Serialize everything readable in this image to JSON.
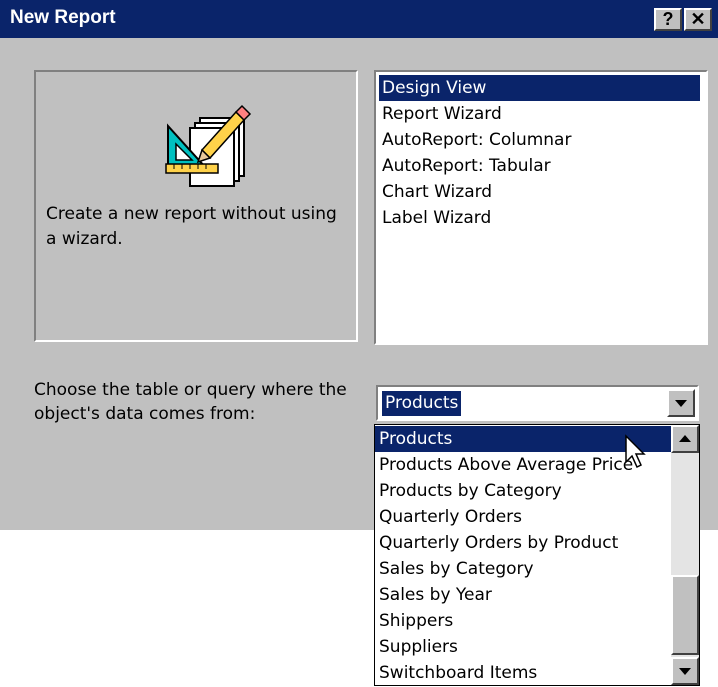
{
  "window": {
    "title": "New Report",
    "help_button": "?",
    "close_button": "✕"
  },
  "preview": {
    "description": "Create a new report without using a wizard.",
    "icon": "design-view-icon"
  },
  "report_types": {
    "items": [
      "Design View",
      "Report Wizard",
      "AutoReport:  Columnar",
      "AutoReport:  Tabular",
      "Chart Wizard",
      "Label Wizard"
    ],
    "selected": "Design View"
  },
  "source": {
    "label": "Choose the table or query where the object's data comes from:",
    "value": "Products"
  },
  "dropdown": {
    "items": [
      "Products",
      "Products Above Average Price",
      "Products by Category",
      "Quarterly Orders",
      "Quarterly Orders by Product",
      "Sales by Category",
      "Sales by Year",
      "Shippers",
      "Suppliers",
      "Switchboard Items"
    ],
    "highlighted": "Products"
  },
  "colors": {
    "titlebar": "#0a246a",
    "dialog_face": "#c0c0c0",
    "selection": "#0a246a"
  }
}
